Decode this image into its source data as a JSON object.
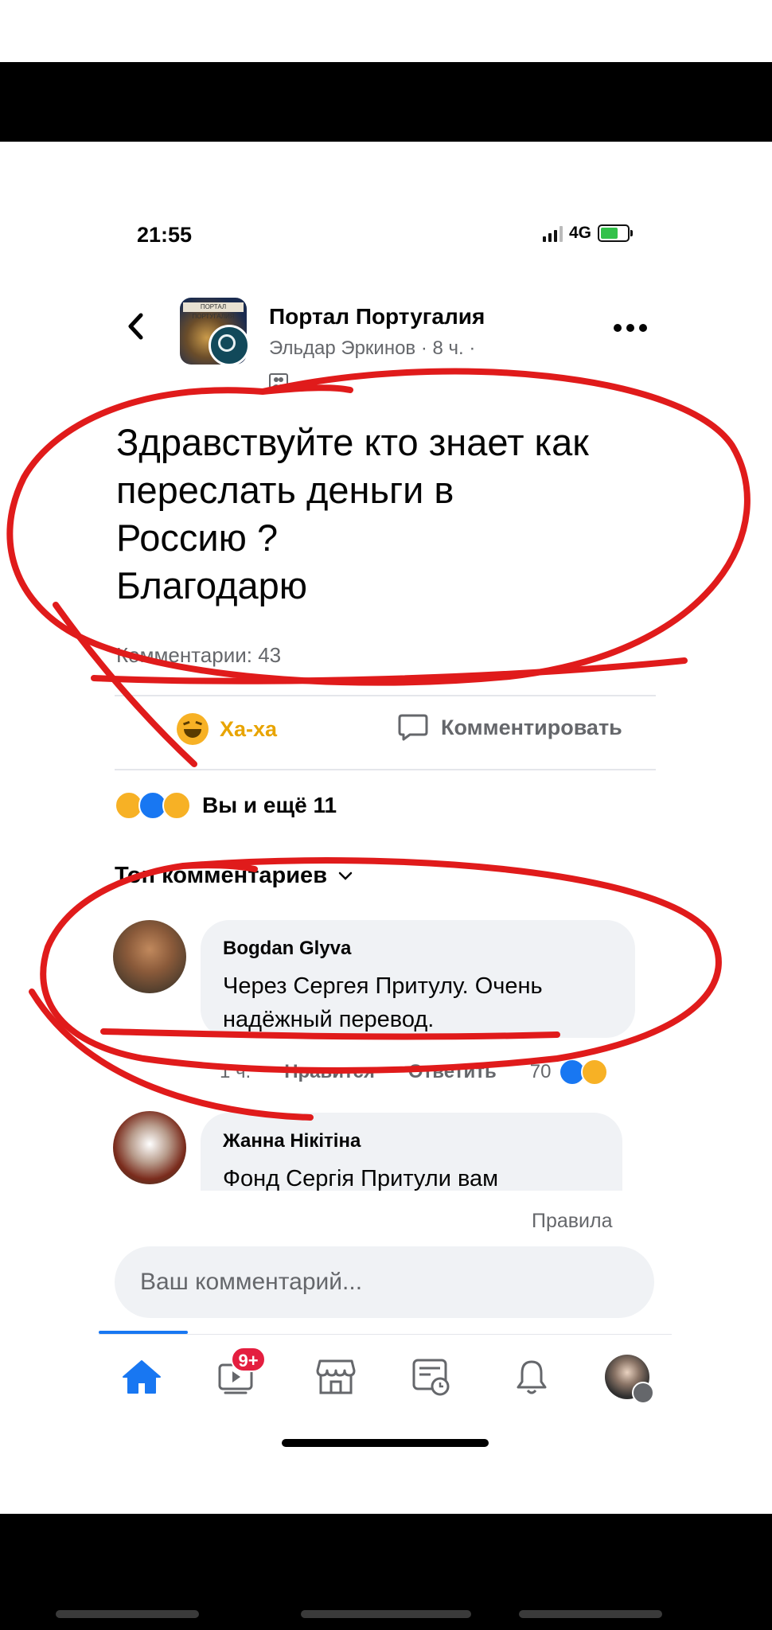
{
  "status_bar": {
    "time": "21:55",
    "network": "4G"
  },
  "header": {
    "group_name": "Портал Португалия",
    "author_meta": "Эльдар Эркинов · 8 ч. ·",
    "avatar_ribbon": "ПОРТАЛ ПОРТУГАЛИЯ",
    "icons": {
      "back": "chevron-left-icon",
      "more": "more-dots-icon",
      "audience": "group-audience-icon"
    }
  },
  "post": {
    "text_lines": [
      "Здравствуйте кто знает как",
      "переслать деньги в",
      "Россию ?",
      "Благодарю"
    ],
    "comments_count": "Комментарии: 43"
  },
  "actions": {
    "haha_label": "Ха-ха",
    "comment_label": "Комментировать"
  },
  "reactions_summary": "Вы и ещё 11",
  "comments_sort": "Топ комментариев",
  "comments": [
    {
      "author": "Bogdan Glyva",
      "text_lines": [
        "Через Сергея Притулу. Очень",
        "надёжный перевод."
      ],
      "time": "1 ч.",
      "like_label": "Нравится",
      "reply_label": "Ответить",
      "reactions_count": "70"
    },
    {
      "author": "Жанна Нікітіна",
      "text_lines": [
        "Фонд Сергія Притули вам"
      ]
    }
  ],
  "footer": {
    "rules_link": "Правила",
    "comment_placeholder": "Ваш комментарий..."
  },
  "tab_bar": {
    "video_badge": "9+",
    "tabs": [
      "home-icon",
      "video-icon",
      "marketplace-icon",
      "feeds-icon",
      "bell-icon",
      "profile-menu"
    ]
  },
  "colors": {
    "brand": "#1877f2",
    "annotation": "#e01b1b",
    "haha": "#f7b125",
    "badge": "#e41e3f"
  }
}
